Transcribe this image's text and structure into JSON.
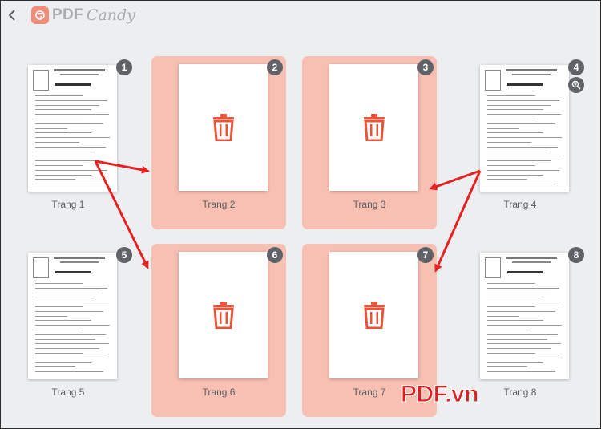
{
  "app": {
    "logo_pdf": "PDF",
    "logo_candy": "Candy"
  },
  "pages": [
    {
      "label": "Trang 1",
      "number": "1",
      "selected": false
    },
    {
      "label": "Trang 2",
      "number": "2",
      "selected": true
    },
    {
      "label": "Trang 3",
      "number": "3",
      "selected": true
    },
    {
      "label": "Trang 4",
      "number": "4",
      "selected": false
    },
    {
      "label": "Trang 5",
      "number": "5",
      "selected": false
    },
    {
      "label": "Trang 6",
      "number": "6",
      "selected": true
    },
    {
      "label": "Trang 7",
      "number": "7",
      "selected": true
    },
    {
      "label": "Trang 8",
      "number": "8",
      "selected": false
    }
  ],
  "icons": {
    "back": "chevron-left-icon",
    "logo": "candy-logo-icon",
    "delete": "trash-icon",
    "zoom": "zoom-in-icon"
  },
  "colors": {
    "selected_bg": "#f7c0b3",
    "trash": "#e8553a",
    "badge": "#5f6368",
    "arrow": "#e82020"
  },
  "watermark": "PDF.vn"
}
